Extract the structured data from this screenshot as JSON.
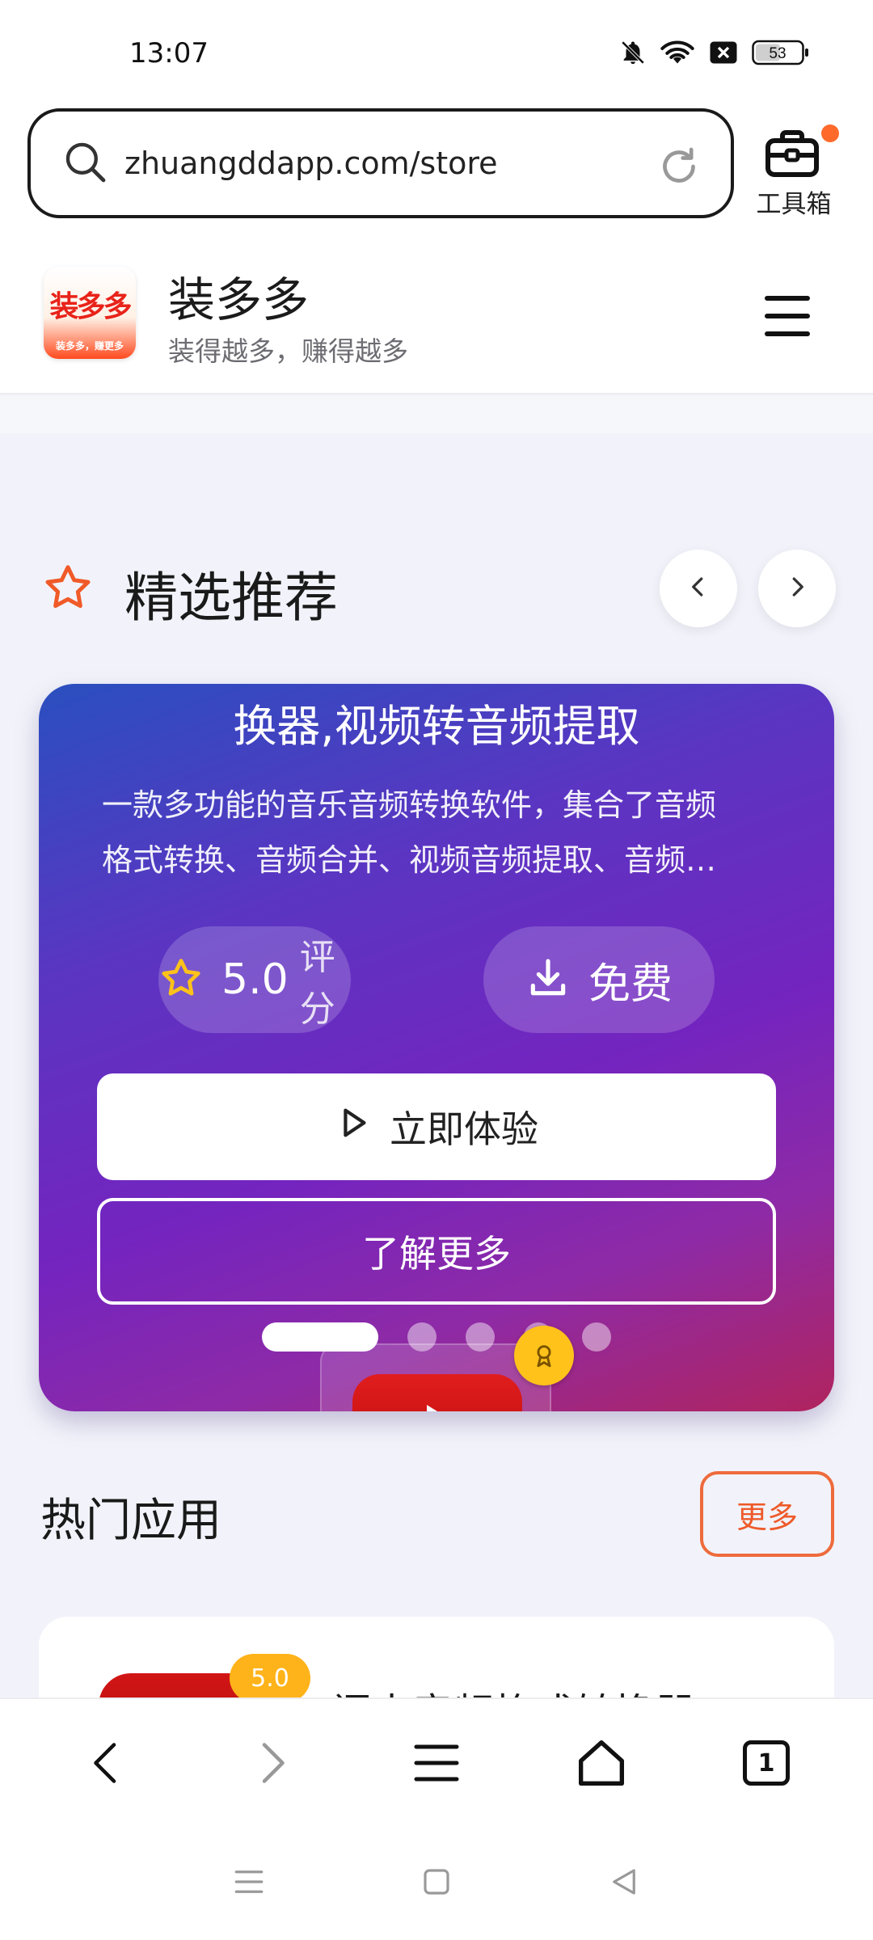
{
  "status_bar": {
    "time": "13:07",
    "battery": "53",
    "icons": [
      "bell-off-icon",
      "wifi-icon",
      "no-sim-icon",
      "battery-icon"
    ]
  },
  "browser": {
    "url": "zhuangddapp.com/store",
    "toolbox_label": "工具箱",
    "icons": [
      "search-icon",
      "reload-icon",
      "toolbox-icon"
    ]
  },
  "site": {
    "logo_text": "装多多",
    "logo_subtext": "装多多，赚更多",
    "name": "装多多",
    "slogan": "装得越多，赚得越多"
  },
  "featured": {
    "title": "精选推荐",
    "icon": "star-icon",
    "prev_icon": "chevron-left-icon",
    "next_icon": "chevron-right-icon",
    "slide": {
      "title": "换器,视频转音频提取",
      "description_lines": [
        "一款多功能的音乐音频转换软件，集合了音频",
        "格式转换、音频合并、视频音频提取、音频…"
      ],
      "rating_value": "5.0",
      "rating_label": "评分",
      "price_label": "免费",
      "primary_button": "立即体验",
      "secondary_button": "了解更多",
      "slide_count": 5,
      "active_slide": 1,
      "accent_colors": [
        "#2a4fbf",
        "#7424bf",
        "#b0245e"
      ]
    }
  },
  "hot_apps": {
    "title": "热门应用",
    "more_label": "更多",
    "first_app": {
      "score": "5.0",
      "name": "闪电音频格式转换器"
    }
  },
  "bottom_nav": {
    "items": [
      "back-icon",
      "forward-icon",
      "menu-icon",
      "home-icon",
      "tabs-icon"
    ],
    "tab_count": "1"
  },
  "system_nav": {
    "items": [
      "recents-icon",
      "home-square-icon",
      "back-triangle-icon"
    ]
  }
}
